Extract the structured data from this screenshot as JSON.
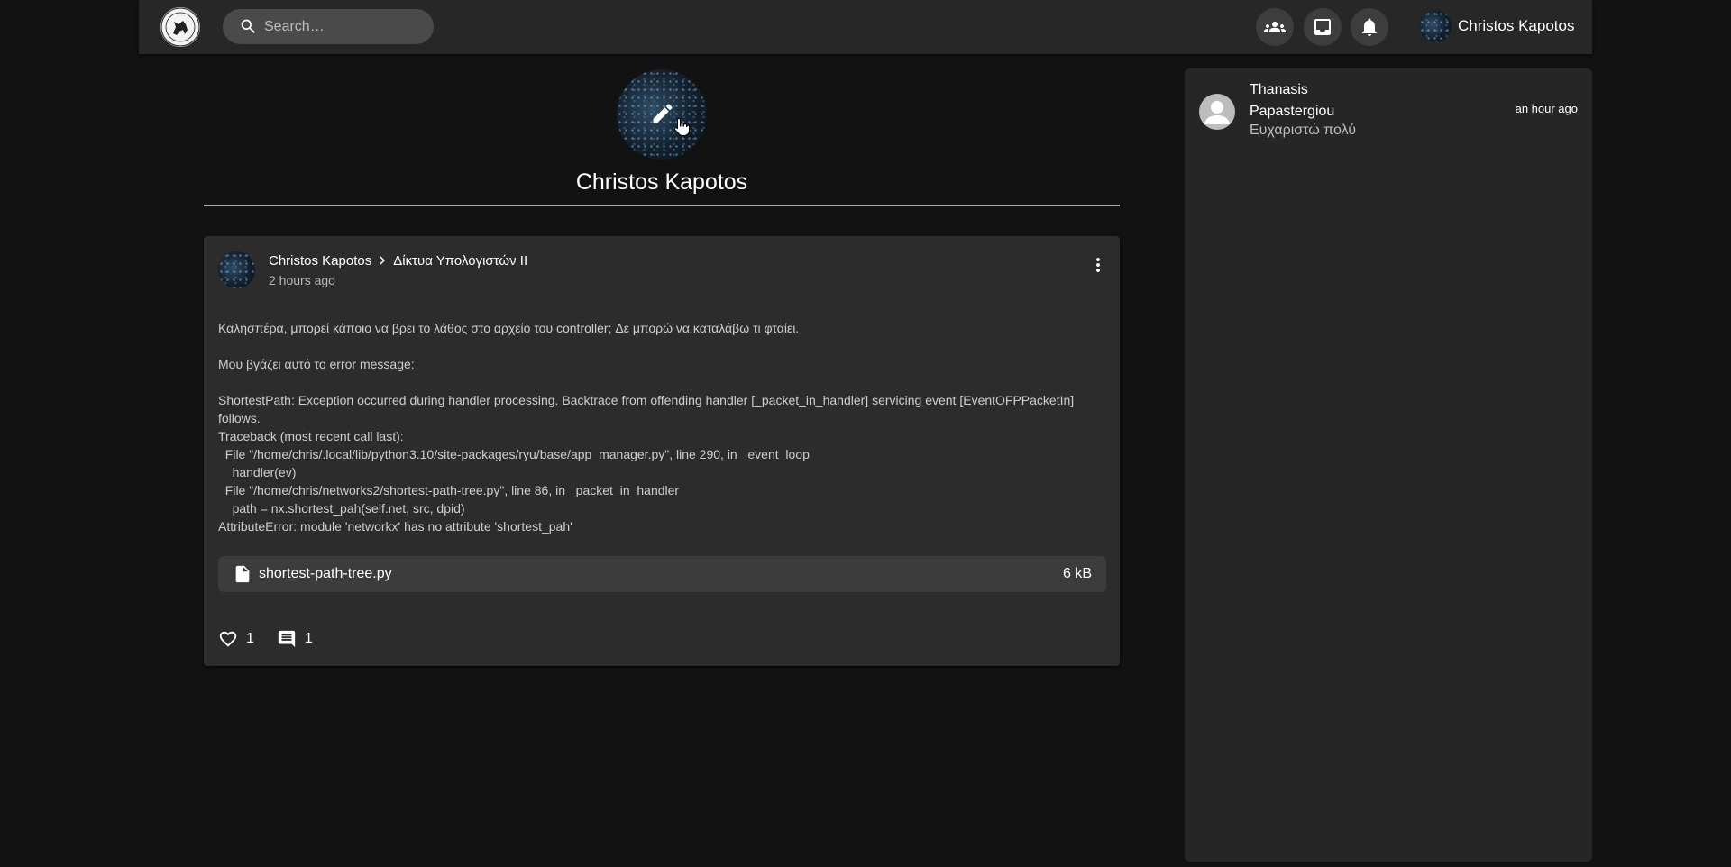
{
  "header": {
    "search_placeholder": "Search…",
    "user_name": "Christos Kapotos"
  },
  "profile": {
    "name": "Christos Kapotos"
  },
  "post": {
    "author": "Christos Kapotos",
    "group": "Δίκτυα Υπολογιστών ΙΙ",
    "time": "2 hours ago",
    "body": "Καλησπέρα, μπορεί κάποιο να βρει το λάθος στο αρχείο του controller; Δε μπορώ να καταλάβω τι φταίει.\n\nΜου βγάζει αυτό το error message:\n\nShortestPath: Exception occurred during handler processing. Backtrace from offending handler [_packet_in_handler] servicing event [EventOFPPacketIn]\nfollows.\nTraceback (most recent call last):\n  File \"/home/chris/.local/lib/python3.10/site-packages/ryu/base/app_manager.py\", line 290, in _event_loop\n    handler(ev)\n  File \"/home/chris/networks2/shortest-path-tree.py\", line 86, in _packet_in_handler\n    path = nx.shortest_pah(self.net, src, dpid)\nAttributeError: module 'networkx' has no attribute 'shortest_pah'",
    "attachment_name": "shortest-path-tree.py",
    "attachment_size": "6 kB",
    "likes": "1",
    "comments": "1"
  },
  "sidebar": {
    "notifications": [
      {
        "name": "Thanasis Papastergiou",
        "time": "an hour ago",
        "message": "Ευχαριστώ πολύ"
      }
    ]
  },
  "icons": [
    "university-logo-icon",
    "search-icon",
    "groups-icon",
    "inbox-icon",
    "bell-icon",
    "pencil-icon",
    "hand-cursor-icon",
    "chevron-right-icon",
    "more-vert-icon",
    "file-icon",
    "heart-outline-icon",
    "comment-icon",
    "person-icon"
  ],
  "colors": {
    "background": "#121212",
    "appbar": "#272727",
    "card": "#2c2c2c",
    "panel": "#262626"
  }
}
